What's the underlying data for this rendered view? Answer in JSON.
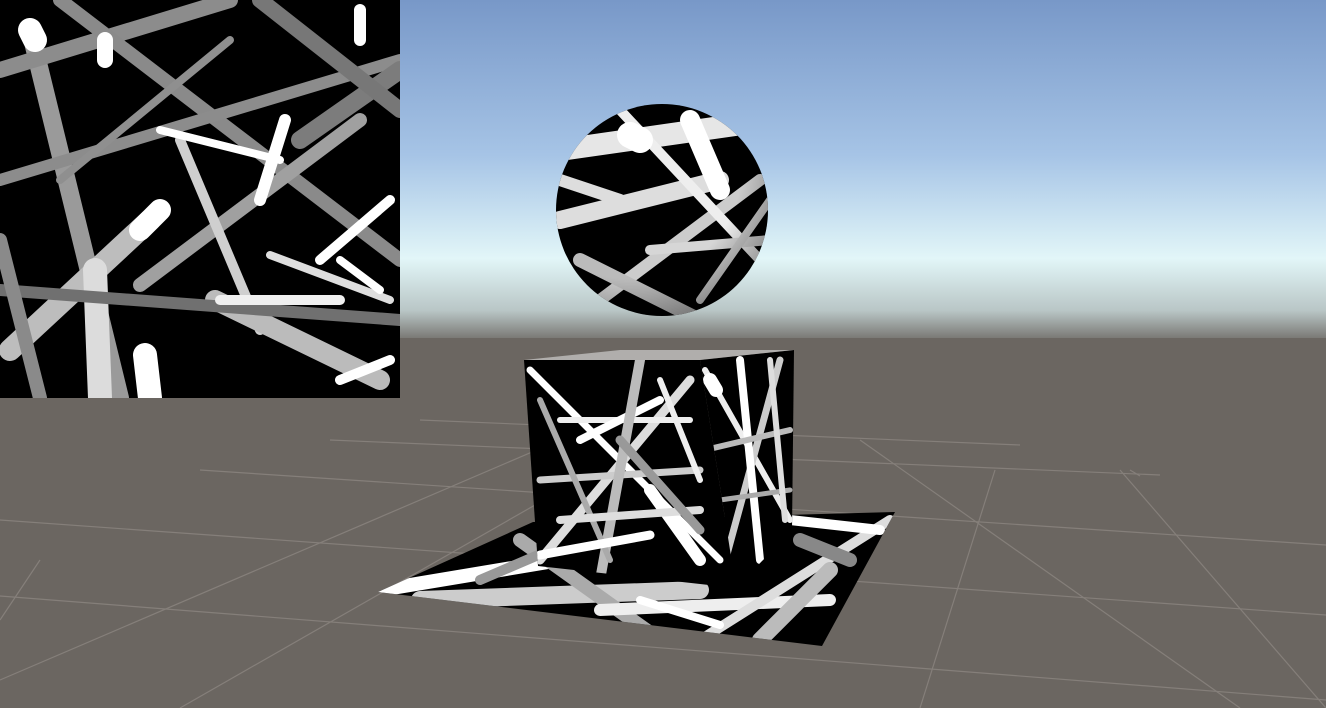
{
  "viewport": {
    "sky_top_color": "#7e9ccc",
    "sky_horizon_color": "#e6f6f8",
    "ground_color": "#6b6661",
    "grid_color": "#8b8681"
  },
  "texture_preview": {
    "background_color": "#000000",
    "stroke_colors": [
      "#ffffff",
      "#d9d9d9",
      "#b3b3b3",
      "#8c8c8c"
    ]
  },
  "scene_objects": [
    {
      "name": "sphere",
      "material": "random-lines-texture"
    },
    {
      "name": "cube",
      "material": "random-lines-texture"
    },
    {
      "name": "plane",
      "material": "random-lines-texture"
    }
  ]
}
